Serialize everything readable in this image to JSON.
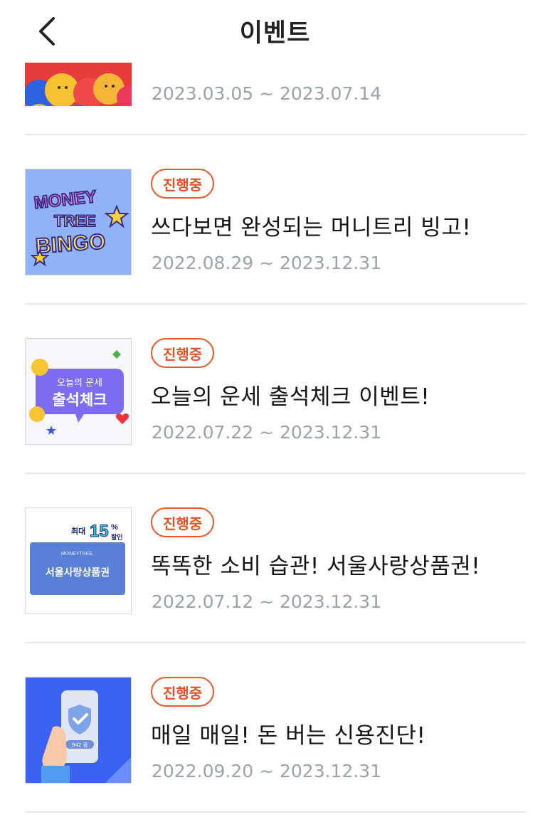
{
  "header": {
    "title": "이벤트",
    "back_icon": "chevron-left-icon"
  },
  "events": [
    {
      "date": "2023.03.05 ~ 2023.07.14",
      "thumb": "emoji-balls-banner"
    },
    {
      "status": "진행중",
      "title": "쓰다보면 완성되는 머니트리 빙고!",
      "date": "2022.08.29 ~ 2023.12.31",
      "thumb_text_1": "MONEY",
      "thumb_text_2": "TREE",
      "thumb_text_3": "BINGO",
      "thumb_bg": "#8fb2f8"
    },
    {
      "status": "진행중",
      "title": "오늘의 운세 출석체크 이벤트!",
      "date": "2022.07.22 ~ 2023.12.31",
      "thumb_text_1": "오늘의 운세",
      "thumb_text_2": "출석체크"
    },
    {
      "status": "진행중",
      "title": "똑똑한 소비 습관! 서울사랑상품권!",
      "date": "2022.07.12 ~ 2023.12.31",
      "thumb_text_1": "최대",
      "thumb_text_2": "15",
      "thumb_text_3": "%",
      "thumb_text_4": "할인",
      "thumb_text_5": "MONEYTREE",
      "thumb_text_6": "서울사랑상품권"
    },
    {
      "status": "진행중",
      "title": "매일 매일! 돈 버는 신용진단!",
      "date": "2022.09.20 ~ 2023.12.31",
      "thumb_text_1": "942 점",
      "thumb_bg": "#3b62f0"
    }
  ],
  "colors": {
    "accent": "#e85a2a",
    "date_gray": "#9aa3ab",
    "divider": "#e8e8e8"
  }
}
